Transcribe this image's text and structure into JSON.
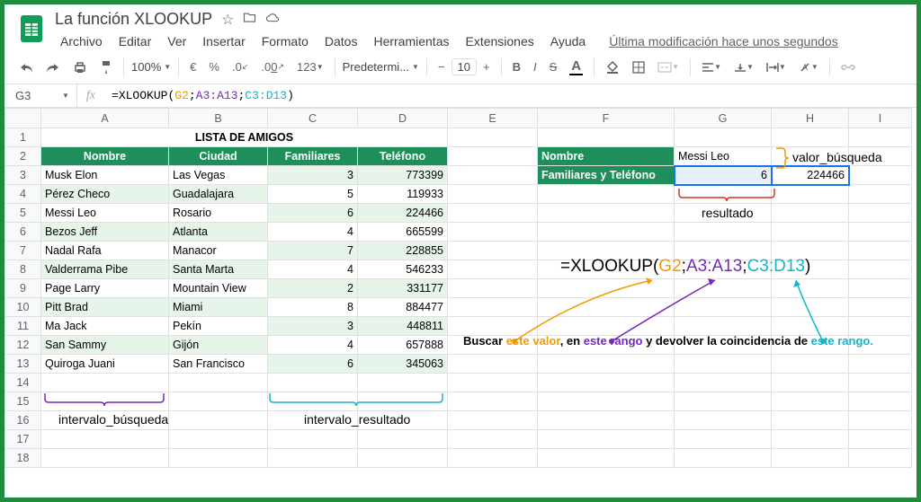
{
  "doc": {
    "title": "La función XLOOKUP"
  },
  "menu": {
    "archivo": "Archivo",
    "editar": "Editar",
    "ver": "Ver",
    "insertar": "Insertar",
    "formato": "Formato",
    "datos": "Datos",
    "herramientas": "Herramientas",
    "extensiones": "Extensiones",
    "ayuda": "Ayuda",
    "lastmod": "Última modificación hace unos segundos"
  },
  "toolbar": {
    "zoom": "100%",
    "currency": "€",
    "pct": "%",
    "dec0": ".0",
    "dec00": ".00",
    "numfmt": "123",
    "font": "Predetermi...",
    "fsize": "10",
    "bold": "B",
    "italic": "I",
    "strike": "S",
    "textcolor": "A"
  },
  "fx": {
    "cellref": "G3",
    "formula_prefix": "=XLOOKUP(",
    "g2": "G2",
    "sep1": ";",
    "a3a13": "A3:A13",
    "sep2": ";",
    "c3d13": "C3:D13",
    "close": ")"
  },
  "cols": [
    "A",
    "B",
    "C",
    "D",
    "E",
    "F",
    "G",
    "H",
    "I"
  ],
  "rows": [
    "1",
    "2",
    "3",
    "4",
    "5",
    "6",
    "7",
    "8",
    "9",
    "10",
    "11",
    "12",
    "13",
    "14",
    "15",
    "16",
    "17",
    "18"
  ],
  "table": {
    "title": "LISTA DE AMIGOS",
    "headers": {
      "a": "Nombre",
      "b": "Ciudad",
      "c": "Familiares",
      "d": "Teléfono"
    },
    "data": [
      {
        "a": "Musk Elon",
        "b": "Las Vegas",
        "c": "3",
        "d": "773399"
      },
      {
        "a": "Pérez Checo",
        "b": "Guadalajara",
        "c": "5",
        "d": "119933"
      },
      {
        "a": "Messi Leo",
        "b": "Rosario",
        "c": "6",
        "d": "224466"
      },
      {
        "a": "Bezos Jeff",
        "b": "Atlanta",
        "c": "4",
        "d": "665599"
      },
      {
        "a": "Nadal Rafa",
        "b": "Manacor",
        "c": "7",
        "d": "228855"
      },
      {
        "a": "Valderrama Pibe",
        "b": "Santa Marta",
        "c": "4",
        "d": "546233"
      },
      {
        "a": "Page Larry",
        "b": "Mountain View",
        "c": "2",
        "d": "331177"
      },
      {
        "a": "Pitt Brad",
        "b": "Miami",
        "c": "8",
        "d": "884477"
      },
      {
        "a": "Ma Jack",
        "b": "Pekín",
        "c": "3",
        "d": "448811"
      },
      {
        "a": "San Sammy",
        "b": "Gijón",
        "c": "4",
        "d": "657888"
      },
      {
        "a": "Quiroga Juani",
        "b": "San Francisco",
        "c": "6",
        "d": "345063"
      }
    ]
  },
  "lookup": {
    "label_nombre": "Nombre",
    "label_fam": "Familiares y Teléfono",
    "val_nombre": "Messi Leo",
    "val_fam": "6",
    "val_tel": "224466"
  },
  "annot": {
    "valor_busqueda": "valor_búsqueda",
    "resultado": "resultado",
    "intervalo_busqueda": "intervalo_búsqueda",
    "intervalo_resultado": "intervalo_resultado",
    "big_eq": "=XLOOKUP(",
    "big_g2": "G2",
    "big_s1": ";",
    "big_a3": "A3",
    "big_colon1": ":",
    "big_a13": "A13",
    "big_s2": ";",
    "big_c3": "C3",
    "big_colon2": ":",
    "big_d13": "D13",
    "big_close": ")",
    "exp_pre": "Buscar ",
    "exp_1": "este valor",
    "exp_mid1": ", en ",
    "exp_2": "este rango",
    "exp_mid2": " y devolver la coincidencia de ",
    "exp_3": "este rango."
  },
  "chart_data": {
    "type": "table",
    "title": "LISTA DE AMIGOS",
    "columns": [
      "Nombre",
      "Ciudad",
      "Familiares",
      "Teléfono"
    ],
    "rows": [
      [
        "Musk Elon",
        "Las Vegas",
        3,
        773399
      ],
      [
        "Pérez Checo",
        "Guadalajara",
        5,
        119933
      ],
      [
        "Messi Leo",
        "Rosario",
        6,
        224466
      ],
      [
        "Bezos Jeff",
        "Atlanta",
        4,
        665599
      ],
      [
        "Nadal Rafa",
        "Manacor",
        7,
        228855
      ],
      [
        "Valderrama Pibe",
        "Santa Marta",
        4,
        546233
      ],
      [
        "Page Larry",
        "Mountain View",
        2,
        331177
      ],
      [
        "Pitt Brad",
        "Miami",
        8,
        884477
      ],
      [
        "Ma Jack",
        "Pekín",
        3,
        448811
      ],
      [
        "San Sammy",
        "Gijón",
        4,
        657888
      ],
      [
        "Quiroga Juani",
        "San Francisco",
        6,
        345063
      ]
    ]
  }
}
